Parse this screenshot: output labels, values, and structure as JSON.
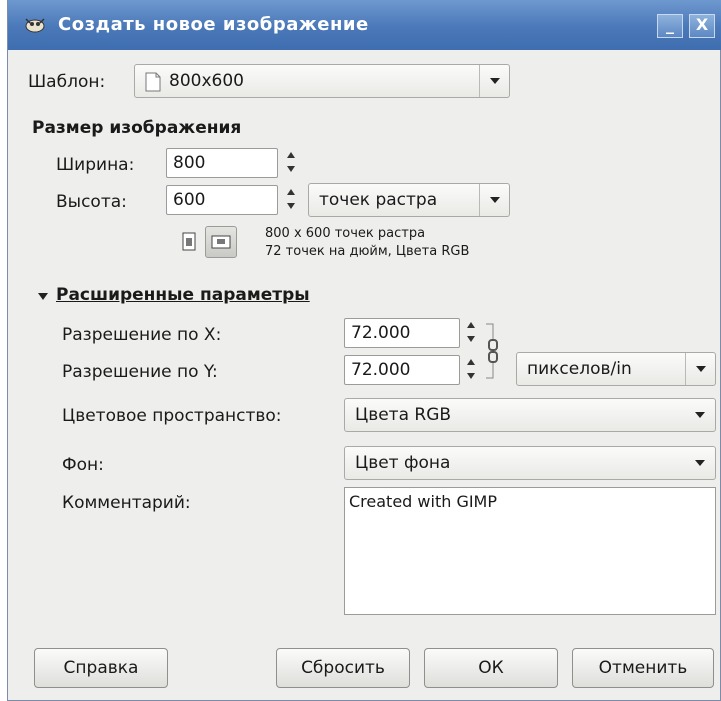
{
  "window": {
    "title": "Создать новое изображение",
    "minimize_label": "_",
    "close_label": "X"
  },
  "template": {
    "label": "Шаблон:",
    "value": "800x600"
  },
  "image_size": {
    "heading": "Размер изображения",
    "width_label": "Ширина:",
    "width_value": "800",
    "height_label": "Высота:",
    "height_value": "600",
    "unit_value": "точек растра",
    "info_line1": "800 x 600 точек растра",
    "info_line2": "72 точек на дюйм, Цвета RGB"
  },
  "advanced": {
    "heading": "Расширенные параметры",
    "res_x_label": "Разрешение по X:",
    "res_x_value": "72.000",
    "res_y_label": "Разрешение по Y:",
    "res_y_value": "72.000",
    "res_unit_value": "пикселов/in",
    "colorspace_label": "Цветовое пространство:",
    "colorspace_value": "Цвета RGB",
    "fill_label": "Фон:",
    "fill_value": "Цвет фона",
    "comment_label": "Комментарий:",
    "comment_value": "Created with GIMP"
  },
  "buttons": {
    "help": "Справка",
    "reset": "Сбросить",
    "ok": "ОК",
    "cancel": "Отменить"
  },
  "colors": {
    "titlebar": "#4a78b8",
    "dialog_bg": "#eeeeec"
  }
}
